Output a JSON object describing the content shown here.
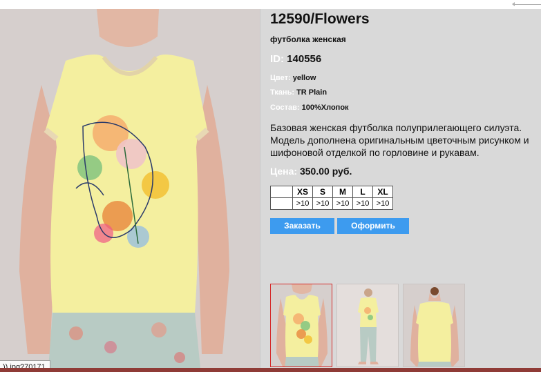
{
  "product": {
    "title": "12590/Flowers",
    "subtitle": "футболка женская",
    "id_label": "ID:",
    "id_value": "140556",
    "attributes": [
      {
        "label": "Цвет:",
        "value": "yellow"
      },
      {
        "label": "Ткань:",
        "value": "TR Plain"
      },
      {
        "label": "Состав:",
        "value": "100%Хлопок"
      }
    ],
    "description": "Базовая женская футболка полуприлегающего силуэта. Модель дополнена оригинальным цветочным рисунком и шифоновой отделкой по горловине и рукавам.",
    "price_label": "Цена:",
    "price_value": "350.00 руб."
  },
  "size_table": {
    "sizes": [
      "XS",
      "S",
      "M",
      "L",
      "XL"
    ],
    "availability": [
      ">10",
      ">10",
      ">10",
      ">10",
      ">10"
    ]
  },
  "buttons": {
    "order": "Заказать",
    "checkout": "Оформить"
  },
  "thumbnails": [
    {
      "name": "front-view",
      "selected": true
    },
    {
      "name": "full-body-view",
      "selected": false
    },
    {
      "name": "back-view",
      "selected": false
    }
  ],
  "status": {
    "url_tooltip": ")).jpg?70171"
  },
  "colors": {
    "button": "#3d9bef",
    "panel_background": "#d9d9d9",
    "selected_thumb_border": "#d52a2a",
    "shirt": "#f4ef9f"
  }
}
